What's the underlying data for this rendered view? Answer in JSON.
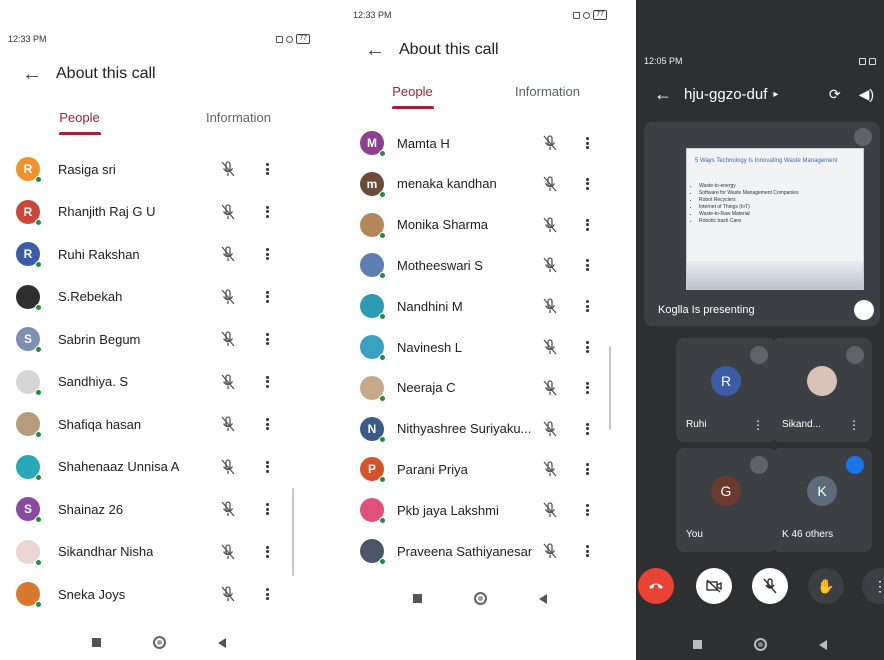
{
  "panel1": {
    "status": {
      "time": "12:33 PM",
      "battery": "77"
    },
    "title": "About this call",
    "tabs": [
      "People",
      "Information"
    ],
    "participants": [
      {
        "name": "Rasiga sri",
        "initial": "R",
        "color": "#f0922d"
      },
      {
        "name": "Rhanjith Raj G U",
        "initial": "R",
        "color": "#c9483a"
      },
      {
        "name": "Ruhi Rakshan",
        "initial": "R",
        "color": "#3c5ca8"
      },
      {
        "name": "S.Rebekah",
        "initial": "",
        "color": "#2e2e2e"
      },
      {
        "name": "Sabrin Begum",
        "initial": "S",
        "color": "#7d8fb0"
      },
      {
        "name": "Sandhiya. S",
        "initial": "",
        "color": "#d6d6d6"
      },
      {
        "name": "Shafiqa hasan",
        "initial": "",
        "color": "#b59c7a"
      },
      {
        "name": "Shahenaaz Unnisa A",
        "initial": "",
        "color": "#27a9b8"
      },
      {
        "name": "Shainaz 26",
        "initial": "S",
        "color": "#8a4aa3"
      },
      {
        "name": "Sikandhar Nisha",
        "initial": "",
        "color": "#e9d6d0"
      },
      {
        "name": "Sneka Joys",
        "initial": "",
        "color": "#d8772f"
      }
    ]
  },
  "panel2": {
    "status": {
      "time": "12:33 PM",
      "battery": "77"
    },
    "title": "About this call",
    "tabs": [
      "People",
      "Information"
    ],
    "participants": [
      {
        "name": "Mamta H",
        "initial": "M",
        "color": "#8c3f8f"
      },
      {
        "name": "menaka kandhan",
        "initial": "m",
        "color": "#6d4b3a"
      },
      {
        "name": "Monika Sharma",
        "initial": "",
        "color": "#b3865b"
      },
      {
        "name": "Motheeswari S",
        "initial": "",
        "color": "#5e7fb1"
      },
      {
        "name": "Nandhini M",
        "initial": "",
        "color": "#2a9bb3"
      },
      {
        "name": "Navinesh L",
        "initial": "",
        "color": "#3aa1c2"
      },
      {
        "name": "Neeraja C",
        "initial": "",
        "color": "#c7a88b"
      },
      {
        "name": "Nithyashree Suriyaku...",
        "initial": "N",
        "color": "#3a5a88"
      },
      {
        "name": "Parani Priya",
        "initial": "P",
        "color": "#d4532d"
      },
      {
        "name": "Pkb jaya Lakshmi",
        "initial": "",
        "color": "#e0527a"
      },
      {
        "name": "Praveena Sathiyanesan",
        "initial": "",
        "color": "#4a5668"
      }
    ]
  },
  "panel3": {
    "status": {
      "time": "12:05 PM"
    },
    "meeting_code": "hju-ggzo-duf",
    "presenting_label": "Koglla Is presenting",
    "slide": {
      "heading": "5 Ways Technology Is Innovating Waste Management",
      "bullets": [
        "Waste-to-energy",
        "Software for Waste Management Companies",
        "Robot Recyclers",
        "Internet of Things (IoT)",
        "Waste-to-Raw Material",
        "Robotic trash Cans"
      ]
    },
    "tiles": [
      {
        "name": "Ruhi",
        "initial": "R",
        "color": "#3c5ca8"
      },
      {
        "name": "Sikand...",
        "initial": "",
        "color": "#d9c2b8"
      },
      {
        "name": "You",
        "initial": "G",
        "color": "#6b3a2e"
      },
      {
        "name": "K  46 others",
        "initial": "K",
        "color": "#5d6b7a"
      }
    ]
  }
}
